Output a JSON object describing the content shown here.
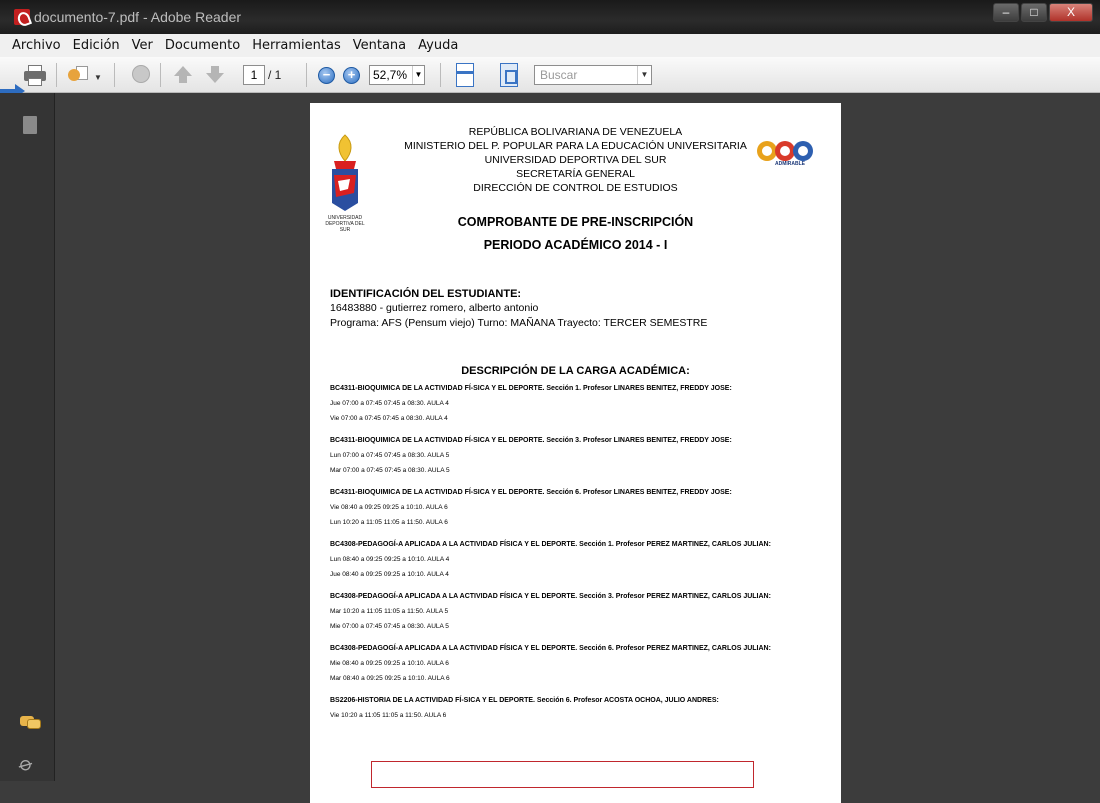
{
  "window": {
    "title": "documento-7.pdf - Adobe Reader",
    "controls": [
      "–",
      "□",
      "X"
    ]
  },
  "menu": [
    "Archivo",
    "Edición",
    "Ver",
    "Documento",
    "Herramientas",
    "Ventana",
    "Ayuda"
  ],
  "toolbar": {
    "page_current": "1",
    "page_total": "/ 1",
    "zoom": "52,7%",
    "search_placeholder": "Buscar"
  },
  "document": {
    "header_lines": [
      "REPÚBLICA BOLIVARIANA DE VENEZUELA",
      "MINISTERIO DEL P. POPULAR PARA LA EDUCACIÓN UNIVERSITARIA",
      "UNIVERSIDAD DEPORTIVA DEL SUR",
      "SECRETARÍA GENERAL",
      "DIRECCIÓN DE CONTROL DE ESTUDIOS"
    ],
    "logo_left_text": "UNIVERSIDAD DEPORTIVA DEL SUR",
    "logo_right_text": "ADMIRABLE",
    "title": "COMPROBANTE DE PRE-INSCRIPCIÓN",
    "period": "PERIODO ACADÉMICO 2014 - I",
    "student": {
      "heading": "IDENTIFICACIÓN DEL ESTUDIANTE:",
      "name_line": "16483880 - gutierrez romero, alberto antonio",
      "program_line": "Programa: AFS (Pensum viejo) Turno: MAÑANA Trayecto: TERCER SEMESTRE"
    },
    "carga_heading": "DESCRIPCIÓN DE LA CARGA ACADÉMICA:",
    "courses": [
      {
        "title": "BC4311-BIOQUIMICA DE LA ACTIVIDAD FÍ-SICA Y EL DEPORTE. Sección 1. Profesor LINARES BENITEZ, FREDDY JOSE:",
        "lines": [
          "Jue 07:00 a 07:45  07:45 a 08:30. AULA 4",
          "Vie 07:00 a 07:45  07:45 a 08:30. AULA 4"
        ]
      },
      {
        "title": "BC4311-BIOQUIMICA DE LA ACTIVIDAD FÍ-SICA Y EL DEPORTE. Sección 3. Profesor LINARES BENITEZ, FREDDY JOSE:",
        "lines": [
          "Lun 07:00 a 07:45  07:45 a 08:30. AULA 5",
          "Mar 07:00 a 07:45  07:45 a 08:30. AULA 5"
        ]
      },
      {
        "title": "BC4311-BIOQUIMICA DE LA ACTIVIDAD FÍ-SICA Y EL DEPORTE. Sección 6. Profesor LINARES BENITEZ, FREDDY JOSE:",
        "lines": [
          "Vie 08:40 a 09:25  09:25 a 10:10. AULA 6",
          "Lun 10:20 a 11:05  11:05 a 11:50. AULA 6"
        ]
      },
      {
        "title": "BC4308-PEDAGOGÍ-A APLICADA A LA ACTIVIDAD FÍSICA Y EL DEPORTE. Sección 1. Profesor PEREZ MARTINEZ, CARLOS JULIAN:",
        "lines": [
          "Lun 08:40 a 09:25  09:25 a 10:10. AULA 4",
          "Jue 08:40 a 09:25  09:25 a 10:10. AULA 4"
        ]
      },
      {
        "title": "BC4308-PEDAGOGÍ-A APLICADA A LA ACTIVIDAD FÍSICA Y EL DEPORTE. Sección 3. Profesor PEREZ MARTINEZ, CARLOS JULIAN:",
        "lines": [
          "Mar 10:20 a 11:05  11:05 a 11:50. AULA 5",
          "Mie 07:00 a 07:45  07:45 a 08:30. AULA 5"
        ]
      },
      {
        "title": "BC4308-PEDAGOGÍ-A APLICADA A LA ACTIVIDAD FÍSICA Y EL DEPORTE. Sección 6. Profesor PEREZ MARTINEZ, CARLOS JULIAN:",
        "lines": [
          "Mie 08:40 a 09:25  09:25 a 10:10. AULA 6",
          "Mar 08:40 a 09:25  09:25 a 10:10. AULA 6"
        ]
      },
      {
        "title": "BS2206-HISTORIA DE LA ACTIVIDAD FÍ-SICA Y EL DEPORTE. Sección 6. Profesor ACOSTA OCHOA, JULIO ANDRES:",
        "lines": [
          "Vie 10:20 a 11:05  11:05 a 11:50. AULA 6"
        ]
      }
    ]
  },
  "icons": {
    "print": "printer-icon",
    "collaborate": "collaborate-icon",
    "hand": "hand-tool-icon",
    "prev": "arrow-up-icon",
    "next": "arrow-down-icon",
    "zoom_out": "zoom-out-icon",
    "zoom_in": "zoom-in-icon",
    "fit_width": "fit-width-icon",
    "fit_page": "fit-page-icon",
    "pages": "pages-panel-icon",
    "comments": "comments-icon",
    "attachments": "attachment-icon"
  },
  "colors": {
    "titlebar": "#1d1d1d",
    "sidebar": "#343434",
    "viewer_bg": "#3c3c3c",
    "accent_blue": "#2d6cc0",
    "signature_box_border": "#c0272d"
  }
}
